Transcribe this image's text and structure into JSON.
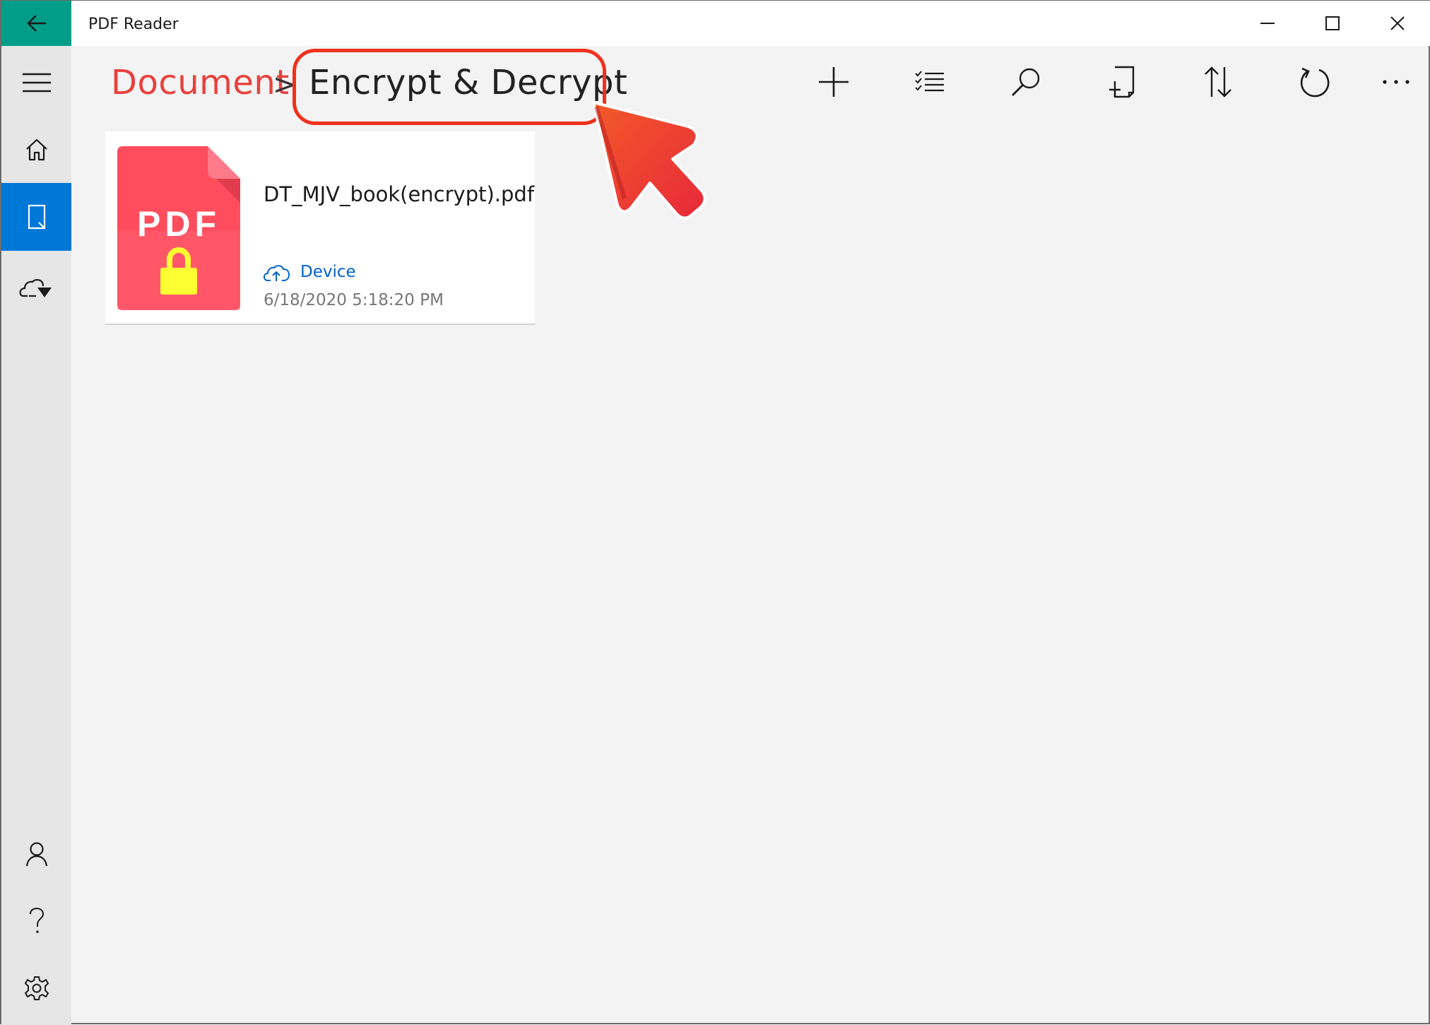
{
  "window": {
    "title": "PDF Reader"
  },
  "header": {
    "breadcrumb_root": "Document",
    "breadcrumb_separator": ">",
    "breadcrumb_current": "Encrypt & Decrypt"
  },
  "toolbar": {
    "icons": [
      "add-icon",
      "select-list-icon",
      "search-icon",
      "new-file-icon",
      "sort-icon",
      "refresh-icon",
      "more-icon"
    ]
  },
  "sidebar": {
    "items": [
      {
        "icon": "hamburger-menu-icon"
      },
      {
        "icon": "home-icon"
      },
      {
        "icon": "document-icon",
        "active": true
      },
      {
        "icon": "cloud-icon"
      },
      {
        "icon": "user-icon"
      },
      {
        "icon": "help-icon"
      },
      {
        "icon": "settings-icon"
      }
    ]
  },
  "files": [
    {
      "thumbnail_text": "PDF",
      "name": "DT_MJV_book(encrypt).pdf",
      "location": "Device",
      "date": "6/18/2020 5:18:20 PM"
    }
  ],
  "colors": {
    "accent_teal": "#009e88",
    "accent_blue": "#0078d7",
    "breadcrumb_red": "#e8413d",
    "highlight_red": "#f0311c",
    "pdf_pink": "#ff4d5e",
    "lock_yellow": "#ffff33"
  }
}
